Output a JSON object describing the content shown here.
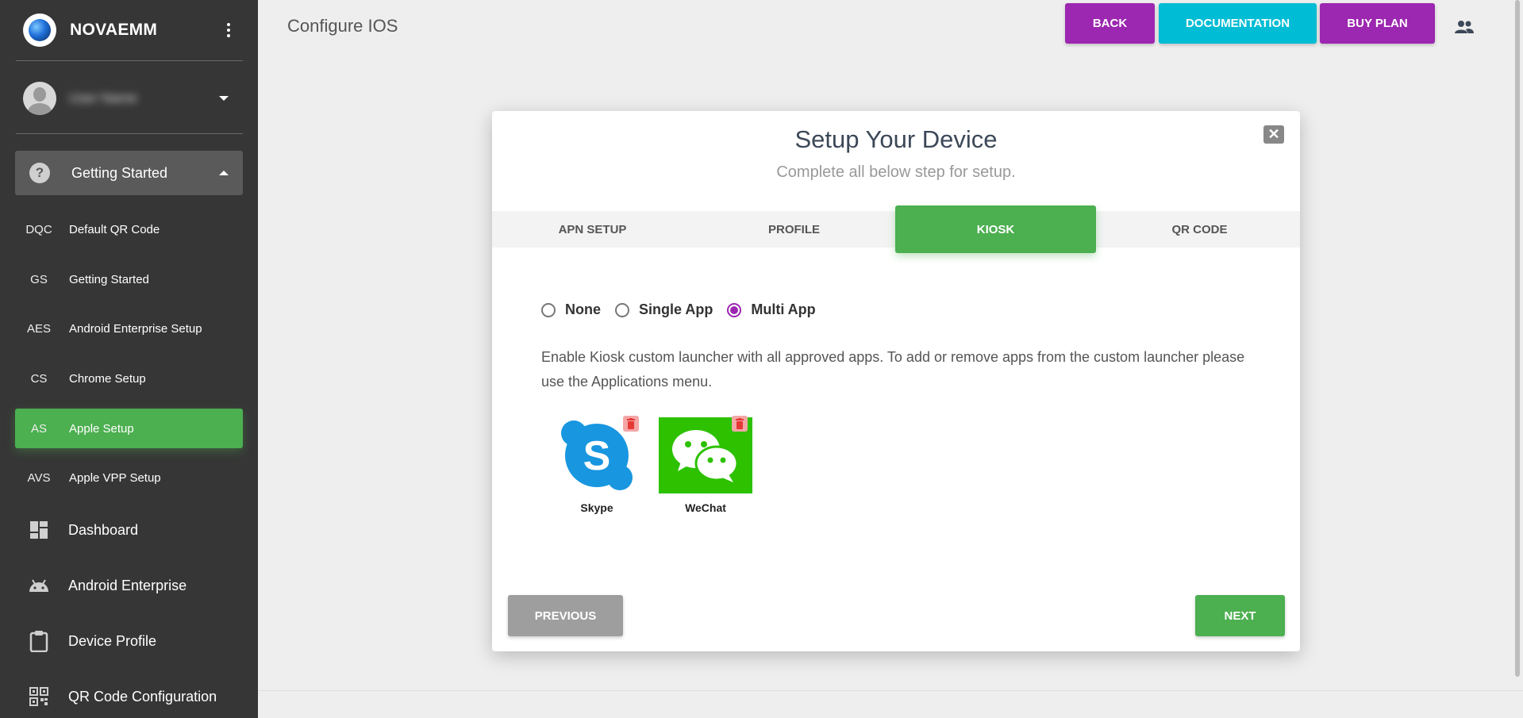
{
  "app": {
    "brand": "NOVAEMM",
    "user_name": "User Name",
    "page_title": "Configure IOS"
  },
  "sidebar": {
    "group_label": "Getting Started",
    "sub_items": [
      {
        "abbr": "DQC",
        "label": "Default QR Code",
        "active": false
      },
      {
        "abbr": "GS",
        "label": "Getting Started",
        "active": false
      },
      {
        "abbr": "AES",
        "label": "Android Enterprise Setup",
        "active": false
      },
      {
        "abbr": "CS",
        "label": "Chrome Setup",
        "active": false
      },
      {
        "abbr": "AS",
        "label": "Apple Setup",
        "active": true
      },
      {
        "abbr": "AVS",
        "label": "Apple VPP Setup",
        "active": false
      }
    ],
    "main_items": [
      {
        "icon": "dashboard-icon",
        "label": "Dashboard"
      },
      {
        "icon": "android-icon",
        "label": "Android Enterprise"
      },
      {
        "icon": "clipboard-icon",
        "label": "Device Profile"
      },
      {
        "icon": "qr-code-icon",
        "label": "QR Code Configuration"
      }
    ]
  },
  "header": {
    "back_label": "BACK",
    "documentation_label": "DOCUMENTATION",
    "buy_plan_label": "BUY PLAN",
    "accent_purple": "#9c27b0",
    "accent_cyan": "#00bcd4"
  },
  "modal": {
    "title": "Setup Your Device",
    "subtitle": "Complete all below step for setup.",
    "tabs": [
      {
        "label": "APN SETUP",
        "active": false
      },
      {
        "label": "PROFILE",
        "active": false
      },
      {
        "label": "KIOSK",
        "active": true
      },
      {
        "label": "QR CODE",
        "active": false
      }
    ],
    "kiosk_options": [
      {
        "label": "None",
        "checked": false
      },
      {
        "label": "Single App",
        "checked": false
      },
      {
        "label": "Multi App",
        "checked": true
      }
    ],
    "description": "Enable Kiosk custom launcher with all approved apps. To add or remove apps from the custom launcher please use the Applications menu.",
    "apps": [
      {
        "name": "Skype",
        "icon": "skype-icon"
      },
      {
        "name": "WeChat",
        "icon": "wechat-icon"
      }
    ],
    "previous_label": "PREVIOUS",
    "next_label": "NEXT",
    "accent_green": "#4caf50"
  }
}
